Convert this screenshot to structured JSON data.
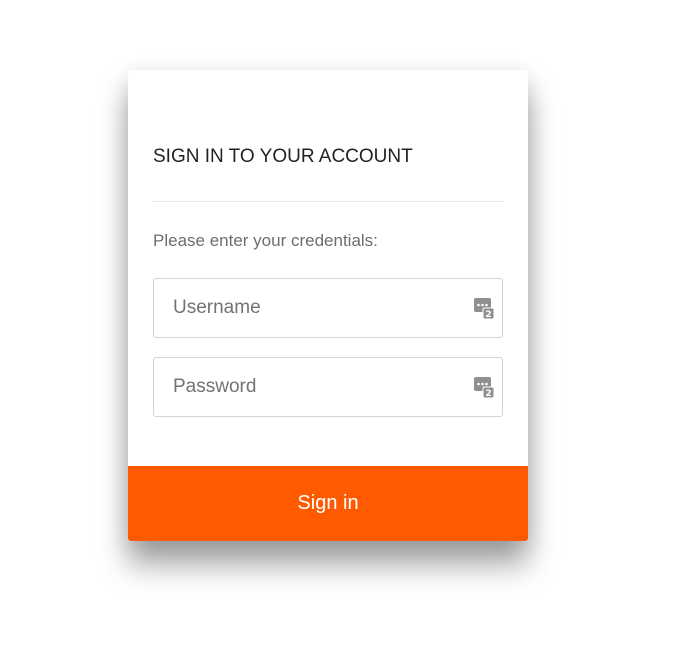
{
  "login": {
    "title": "SIGN IN TO YOUR ACCOUNT",
    "subtitle": "Please enter your credentials:",
    "username": {
      "placeholder": "Username",
      "value": "",
      "icon": "password-manager-icon"
    },
    "password": {
      "placeholder": "Password",
      "value": "",
      "icon": "password-manager-icon"
    },
    "signin_label": "Sign in"
  },
  "colors": {
    "accent": "#ff5a00",
    "title_text": "#1f2225",
    "muted_text": "#6d6d6d",
    "field_border": "#d4d4d4",
    "icon_gray": "#9a9a9a"
  }
}
